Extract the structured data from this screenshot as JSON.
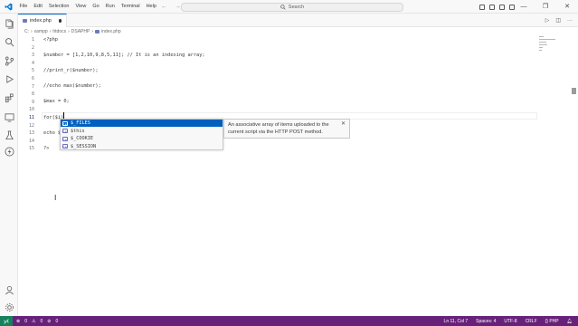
{
  "menu": [
    "File",
    "Edit",
    "Selection",
    "View",
    "Go",
    "Run",
    "Terminal",
    "Help"
  ],
  "search": {
    "label": "Search"
  },
  "tab": {
    "filename": "index.php"
  },
  "breadcrumb": [
    "C:",
    "xampp",
    "htdocs",
    "DSAPHP",
    "index.php"
  ],
  "code_lines": [
    "<?php",
    "",
    "$number = [1,2,10,9,8,5,11]; // It is an indexing array;",
    "",
    "//print_r($number);",
    "",
    "//echo max($number);",
    "",
    "$max = 0;",
    "",
    "for($i)",
    "",
    "echo $",
    "",
    "?>"
  ],
  "line_numbers": [
    "1",
    "2",
    "3",
    "4",
    "5",
    "6",
    "7",
    "8",
    "9",
    "10",
    "11",
    "12",
    "13",
    "14",
    "15"
  ],
  "active_line": 11,
  "suggest": {
    "items": [
      "$_FILES",
      "$this",
      "$_COOKIE",
      "$_SESSION"
    ],
    "selected_index": 0,
    "doc": "An associative array of items uploaded to the current script via the HTTP POST method."
  },
  "status": {
    "errors": "0",
    "warnings": "0",
    "position": "Ln 11, Col 7",
    "spaces": "Spaces: 4",
    "encoding": "UTF-8",
    "eol": "CRLF",
    "language": "PHP"
  },
  "colors": {
    "statusbar": "#68217a",
    "remote": "#16825d",
    "suggest_selected": "#0060c0",
    "accent": "#005fb8"
  }
}
